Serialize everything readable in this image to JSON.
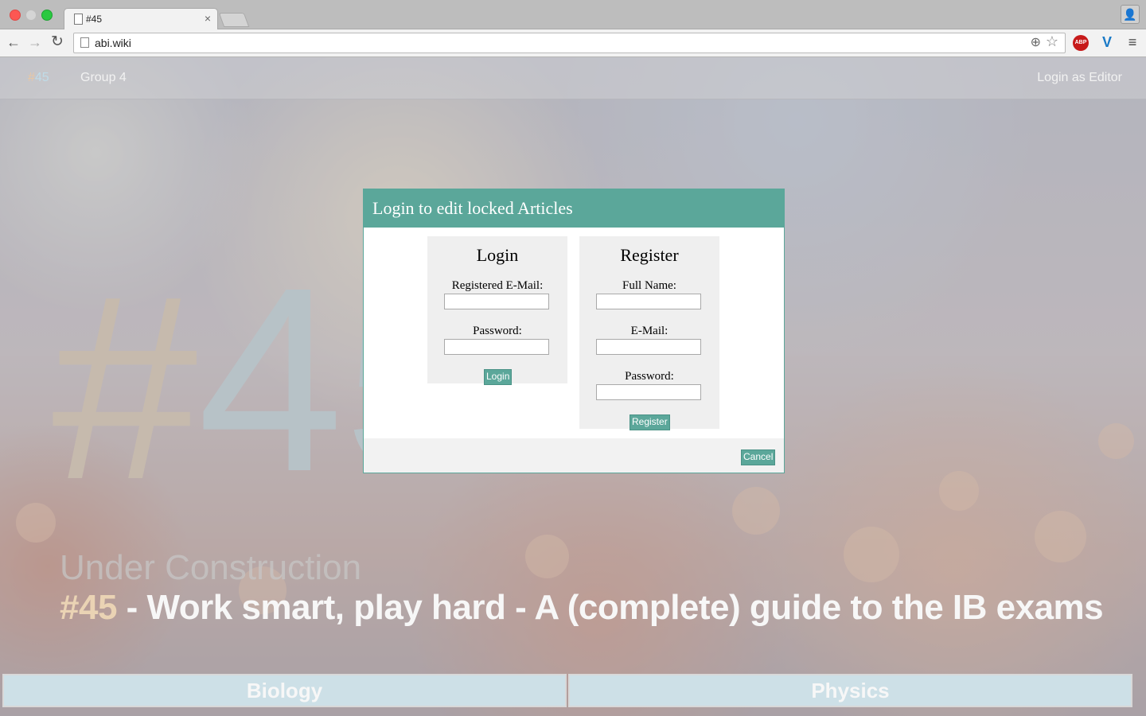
{
  "browser": {
    "tab_title": "#45",
    "tab_close": "×",
    "url": "abi.wiki",
    "back_glyph": "←",
    "forward_glyph": "→",
    "reload_glyph": "↻",
    "zoom_glyph": "⊕",
    "star_glyph": "☆",
    "abp_label": "ABP",
    "ext_v_label": "V",
    "menu_glyph": "≡",
    "profile_glyph": "👤"
  },
  "site_nav": {
    "brand_hash": "#",
    "brand_num": "45",
    "group": "Group 4",
    "login": "Login as Editor"
  },
  "hero": {
    "big_hash": "#",
    "big_num": "45",
    "status": "Under Construction",
    "title_num": "#45",
    "title_text": " - Work smart, play hard - A (complete) guide to the IB exams"
  },
  "subjects": [
    "Biology",
    "Physics"
  ],
  "modal": {
    "title": "Login to edit locked Articles",
    "login": {
      "heading": "Login",
      "email_label": "Registered E-Mail:",
      "password_label": "Password:",
      "button": "Login"
    },
    "register": {
      "heading": "Register",
      "name_label": "Full Name:",
      "email_label": "E-Mail:",
      "password_label": "Password:",
      "button": "Register"
    },
    "cancel": "Cancel"
  },
  "colors": {
    "accent": "#5ba79a",
    "hash_peach": "#e8c7a5",
    "num_blue": "#bfdce8"
  }
}
